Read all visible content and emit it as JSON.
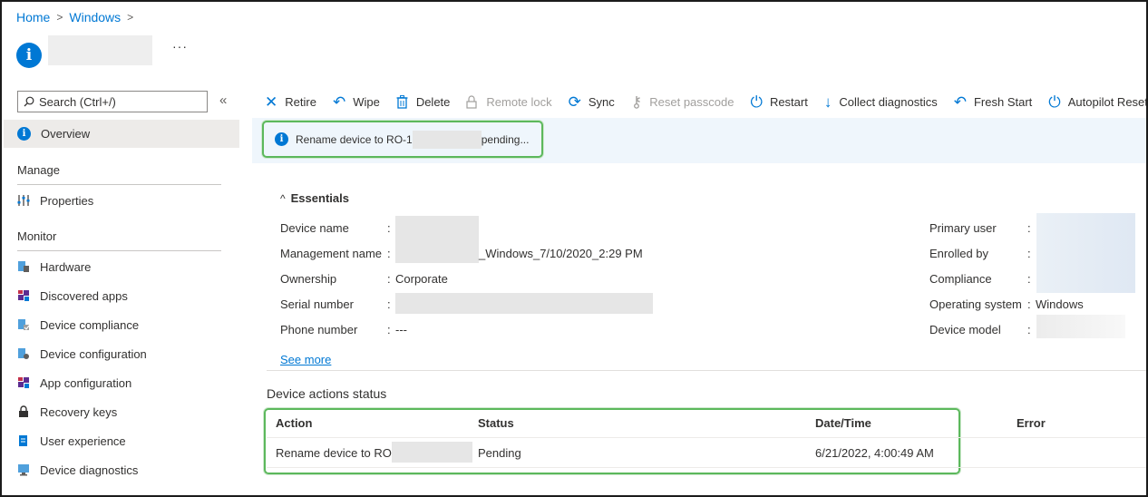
{
  "breadcrumb": {
    "home": "Home",
    "windows": "Windows"
  },
  "title": {
    "more": "···"
  },
  "sidebar": {
    "search_placeholder": "Search (Ctrl+/)",
    "collapse": "«",
    "overview": "Overview",
    "manage_header": "Manage",
    "properties": "Properties",
    "monitor_header": "Monitor",
    "items": [
      {
        "label": "Hardware"
      },
      {
        "label": "Discovered apps"
      },
      {
        "label": "Device compliance"
      },
      {
        "label": "Device configuration"
      },
      {
        "label": "App configuration"
      },
      {
        "label": "Recovery keys"
      },
      {
        "label": "User experience"
      },
      {
        "label": "Device diagnostics"
      }
    ]
  },
  "toolbar": {
    "retire": "Retire",
    "wipe": "Wipe",
    "delete": "Delete",
    "remote_lock": "Remote lock",
    "sync": "Sync",
    "reset_passcode": "Reset passcode",
    "restart": "Restart",
    "collect_diagnostics": "Collect diagnostics",
    "fresh_start": "Fresh Start",
    "autopilot_reset": "Autopilot Reset"
  },
  "banner": {
    "prefix": "Rename device to RO-1",
    "suffix": "pending..."
  },
  "essentials": {
    "header": "Essentials",
    "left": [
      {
        "label": "Device name",
        "value": ""
      },
      {
        "label": "Management name",
        "value": "_Windows_7/10/2020_2:29 PM"
      },
      {
        "label": "Ownership",
        "value": "Corporate"
      },
      {
        "label": "Serial number",
        "value": ""
      },
      {
        "label": "Phone number",
        "value": "---"
      }
    ],
    "right": [
      {
        "label": "Primary user",
        "value": ""
      },
      {
        "label": "Enrolled by",
        "value": ""
      },
      {
        "label": "Compliance",
        "value": ""
      },
      {
        "label": "Operating system",
        "value": "Windows"
      },
      {
        "label": "Device model",
        "value": ""
      }
    ],
    "colon": ":",
    "see_more": "See more"
  },
  "device_actions": {
    "header": "Device actions status",
    "columns": {
      "action": "Action",
      "status": "Status",
      "datetime": "Date/Time",
      "error": "Error"
    },
    "rows": [
      {
        "action": "Rename device to RO-",
        "status": "Pending",
        "datetime": "6/21/2022, 4:00:49 AM",
        "error": ""
      }
    ]
  },
  "colors": {
    "accent": "#0078d4",
    "highlight_border": "#5cb85c",
    "banner_bg": "#eff6fc"
  }
}
